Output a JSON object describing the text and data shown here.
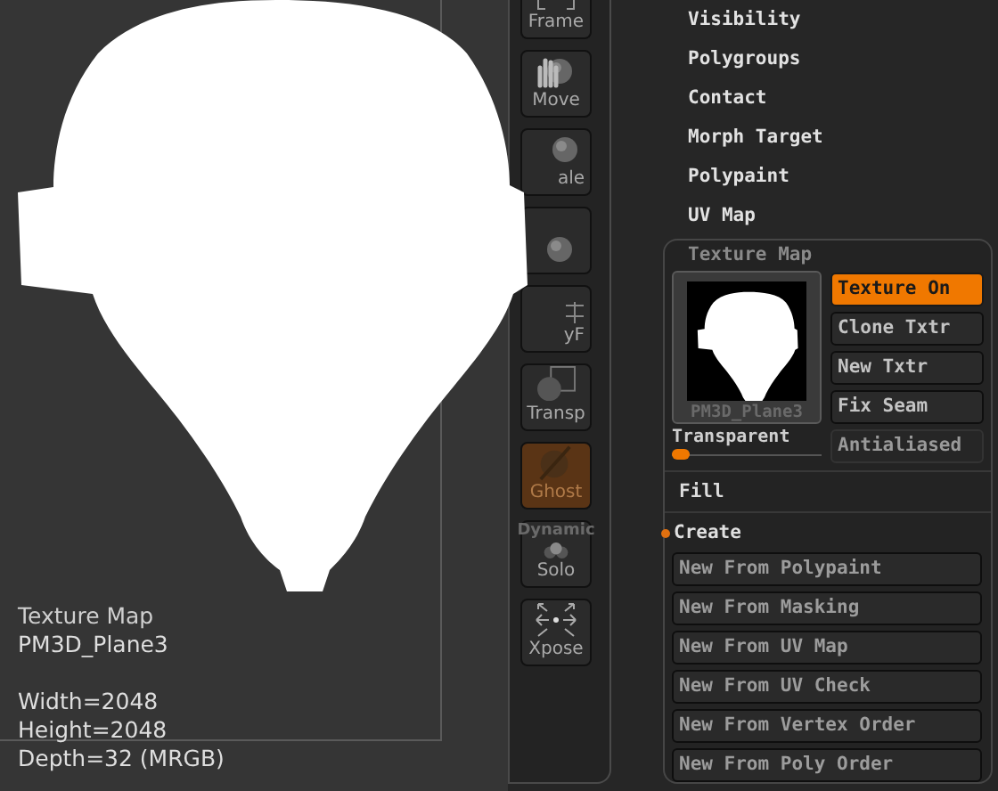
{
  "viewport": {
    "title": "Texture Map",
    "name": "PM3D_Plane3",
    "details": [
      "Width=2048",
      "Height=2048",
      "Depth=32 (MRGB)"
    ]
  },
  "toolbar": [
    {
      "kind": "frame",
      "label": "Frame",
      "on": false
    },
    {
      "kind": "move",
      "label": "Move",
      "on": false
    },
    {
      "kind": "scale",
      "label": "ale",
      "on": false
    },
    {
      "kind": "rotate",
      "on": false
    },
    {
      "kind": "polyf",
      "label": "yF",
      "on": false
    },
    {
      "kind": "transp",
      "label": "Transp",
      "on": false
    },
    {
      "kind": "ghost",
      "label": "Ghost",
      "on": true
    },
    {
      "kind": "solo",
      "caption": "Dynamic",
      "label": "Solo",
      "on": false
    },
    {
      "kind": "xpose",
      "label": "Xpose",
      "on": false
    }
  ],
  "menu": [
    "Visibility",
    "Polygroups",
    "Contact",
    "Morph Target",
    "Polypaint",
    "UV Map"
  ],
  "texture_map": {
    "title": "Texture Map",
    "thumbnail_label": "PM3D_Plane3",
    "buttons": [
      {
        "label": "Texture On",
        "on": true,
        "disabled": false
      },
      {
        "label": "Clone Txtr",
        "on": false,
        "disabled": false
      },
      {
        "label": "New Txtr",
        "on": false,
        "disabled": false
      },
      {
        "label": "Fix Seam",
        "on": false,
        "disabled": false
      }
    ],
    "slider": {
      "label": "Transparent",
      "level": 0.1
    },
    "side_button": {
      "label": "Antialiased",
      "disabled": true
    },
    "fill": "Fill",
    "create": {
      "label": "Create",
      "expanded": true,
      "buttons": [
        "New From Polypaint",
        "New From Masking",
        "New From UV Map",
        "New From UV Check",
        "New From Vertex Order",
        "New From Poly Order"
      ]
    }
  }
}
